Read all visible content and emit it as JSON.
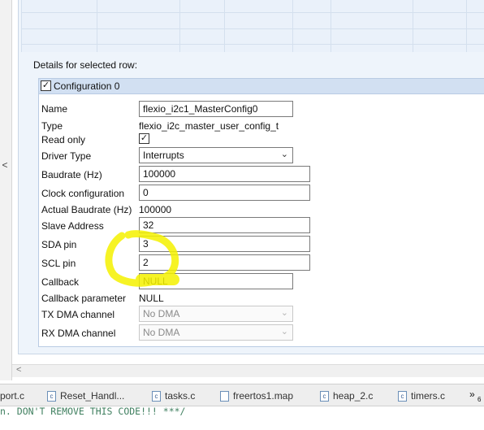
{
  "details_label": "Details for selected row:",
  "config_group": {
    "title": "Configuration 0",
    "checked": true
  },
  "fields": {
    "name": {
      "label": "Name",
      "value": "flexio_i2c1_MasterConfig0"
    },
    "type": {
      "label": "Type",
      "value": "flexio_i2c_master_user_config_t"
    },
    "read_only": {
      "label": "Read only",
      "checked": true
    },
    "driver_type": {
      "label": "Driver Type",
      "value": "Interrupts"
    },
    "baudrate": {
      "label": "Baudrate (Hz)",
      "value": "100000"
    },
    "clock_configuration": {
      "label": "Clock configuration",
      "value": "0"
    },
    "actual_baudrate": {
      "label": "Actual Baudrate (Hz)",
      "value": "100000"
    },
    "slave_address": {
      "label": "Slave Address",
      "value": "32"
    },
    "sda_pin": {
      "label": "SDA pin",
      "value": "3"
    },
    "scl_pin": {
      "label": "SCL pin",
      "value": "2"
    },
    "callback": {
      "label": "Callback",
      "value": "NULL"
    },
    "callback_parameter": {
      "label": "Callback parameter",
      "value": "NULL"
    },
    "tx_dma_channel": {
      "label": "TX DMA channel",
      "value": "No DMA"
    },
    "rx_dma_channel": {
      "label": "RX DMA channel",
      "value": "No DMA"
    }
  },
  "editor_tabs": [
    {
      "label": "port.c"
    },
    {
      "label": "Reset_Handl..."
    },
    {
      "label": "tasks.c"
    },
    {
      "label": "freertos1.map"
    },
    {
      "label": "heap_2.c"
    },
    {
      "label": "timers.c"
    }
  ],
  "tab_overflow": {
    "glyph": "»",
    "count": "6"
  },
  "code_line": "n. DON'T REMOVE THIS CODE!!! ***/",
  "annotation_color": "#f5f200"
}
